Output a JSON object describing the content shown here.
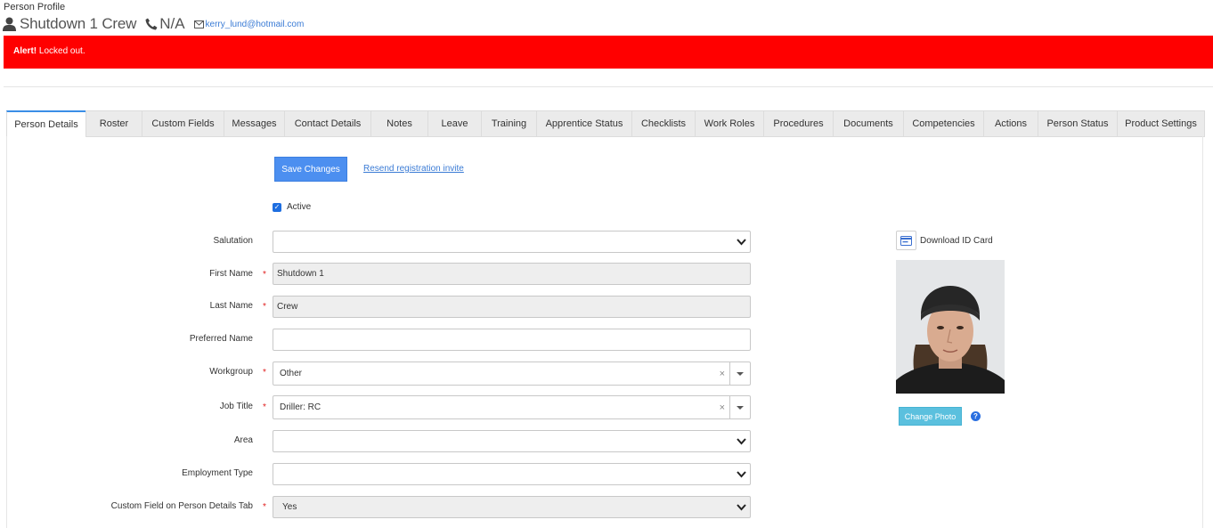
{
  "header": {
    "page_label": "Person Profile",
    "name": "Shutdown 1 Crew",
    "phone": "N/A",
    "email": "kerry_lund@hotmail.com"
  },
  "alert": {
    "strong": "Alert!",
    "message": " Locked out.",
    "color": "#ff0000"
  },
  "tabs": [
    "Person Details",
    "Roster",
    "Custom Fields",
    "Messages",
    "Contact Details",
    "Notes",
    "Leave",
    "Training",
    "Apprentice Status",
    "Checklists",
    "Work Roles",
    "Procedures",
    "Documents",
    "Competencies",
    "Actions",
    "Person Status",
    "Product Settings"
  ],
  "active_tab": "Person Details",
  "actions": {
    "save_label": "Save Changes",
    "resend_label": "Resend registration invite"
  },
  "active_checkbox": {
    "label": "Active",
    "checked": true
  },
  "form": {
    "salutation": {
      "label": "Salutation",
      "value": ""
    },
    "first_name": {
      "label": "First Name",
      "value": "Shutdown 1",
      "required": true
    },
    "last_name": {
      "label": "Last Name",
      "value": "Crew",
      "required": true
    },
    "preferred_name": {
      "label": "Preferred Name",
      "value": ""
    },
    "workgroup": {
      "label": "Workgroup",
      "value": "Other",
      "required": true
    },
    "job_title": {
      "label": "Job Title",
      "value": "Driller: RC",
      "required": true
    },
    "area": {
      "label": "Area",
      "value": ""
    },
    "employment_type": {
      "label": "Employment Type",
      "value": ""
    },
    "custom_field": {
      "label": "Custom Field on Person Details Tab",
      "value": "Yes",
      "required": true
    }
  },
  "required_marker": "*",
  "sidebar": {
    "download_id_label": "Download ID Card",
    "change_photo_label": "Change Photo",
    "help_glyph": "?"
  },
  "colors": {
    "primary": "#4c8ff0",
    "info": "#5bc0de",
    "link": "#3a7bd5",
    "required": "#e02020"
  }
}
